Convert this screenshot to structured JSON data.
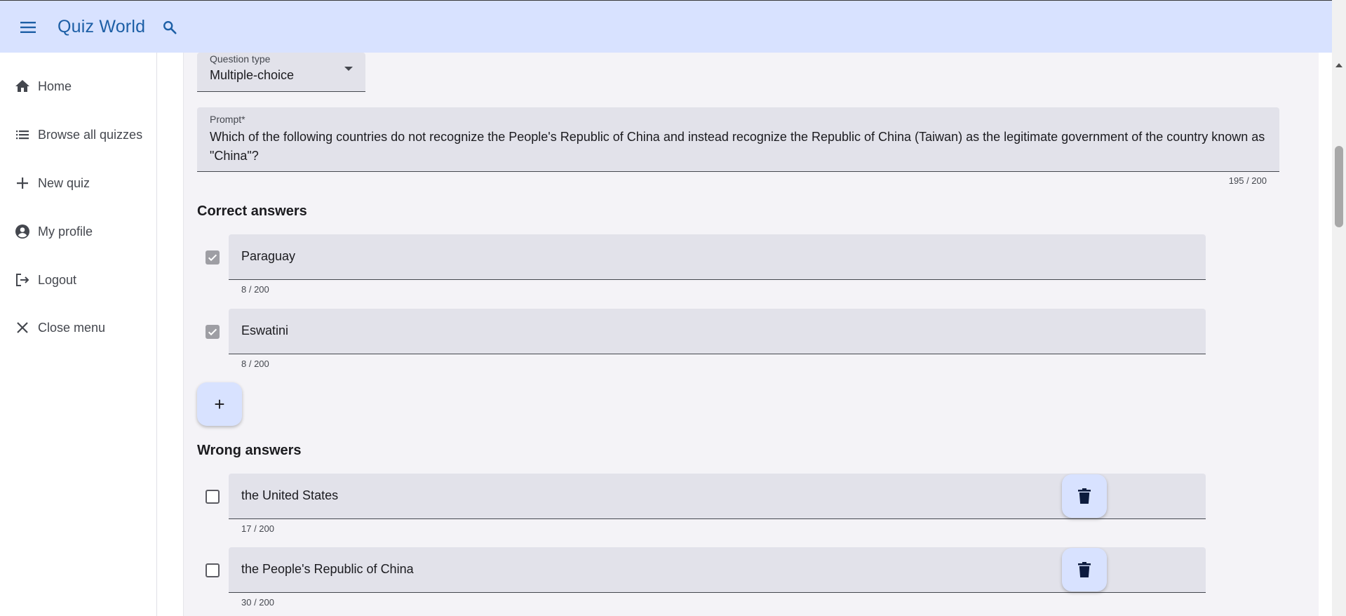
{
  "app": {
    "title": "Quiz World"
  },
  "sidebar": {
    "items": [
      {
        "label": "Home",
        "icon": "home-icon"
      },
      {
        "label": "Browse all quizzes",
        "icon": "list-icon"
      },
      {
        "label": "New quiz",
        "icon": "plus-icon"
      },
      {
        "label": "My profile",
        "icon": "account-circle-icon"
      },
      {
        "label": "Logout",
        "icon": "logout-icon"
      },
      {
        "label": "Close menu",
        "icon": "close-icon"
      }
    ]
  },
  "form": {
    "question_type": {
      "label": "Question type",
      "value": "Multiple-choice"
    },
    "prompt": {
      "label": "Prompt*",
      "value": "Which of the following countries do not recognize the People's Republic of China and instead recognize the Republic of China (Taiwan) as the legitimate government of the country known as \"China\"?",
      "counter": "195 / 200"
    },
    "correct_heading": "Correct answers",
    "correct_answers": [
      {
        "value": "Paraguay",
        "counter": "8 / 200",
        "checked": true
      },
      {
        "value": "Eswatini",
        "counter": "8 / 200",
        "checked": true
      }
    ],
    "add_label": "+",
    "wrong_heading": "Wrong answers",
    "wrong_answers": [
      {
        "value": "the United States",
        "counter": "17 / 200",
        "checked": false
      },
      {
        "value": "the People's Republic of China",
        "counter": "30 / 200",
        "checked": false
      }
    ]
  },
  "colors": {
    "app_bar": "#d8e2ff",
    "title": "#1d5fa6",
    "field_bg": "#e2e2ea",
    "main_bg": "#f4f3f7"
  }
}
